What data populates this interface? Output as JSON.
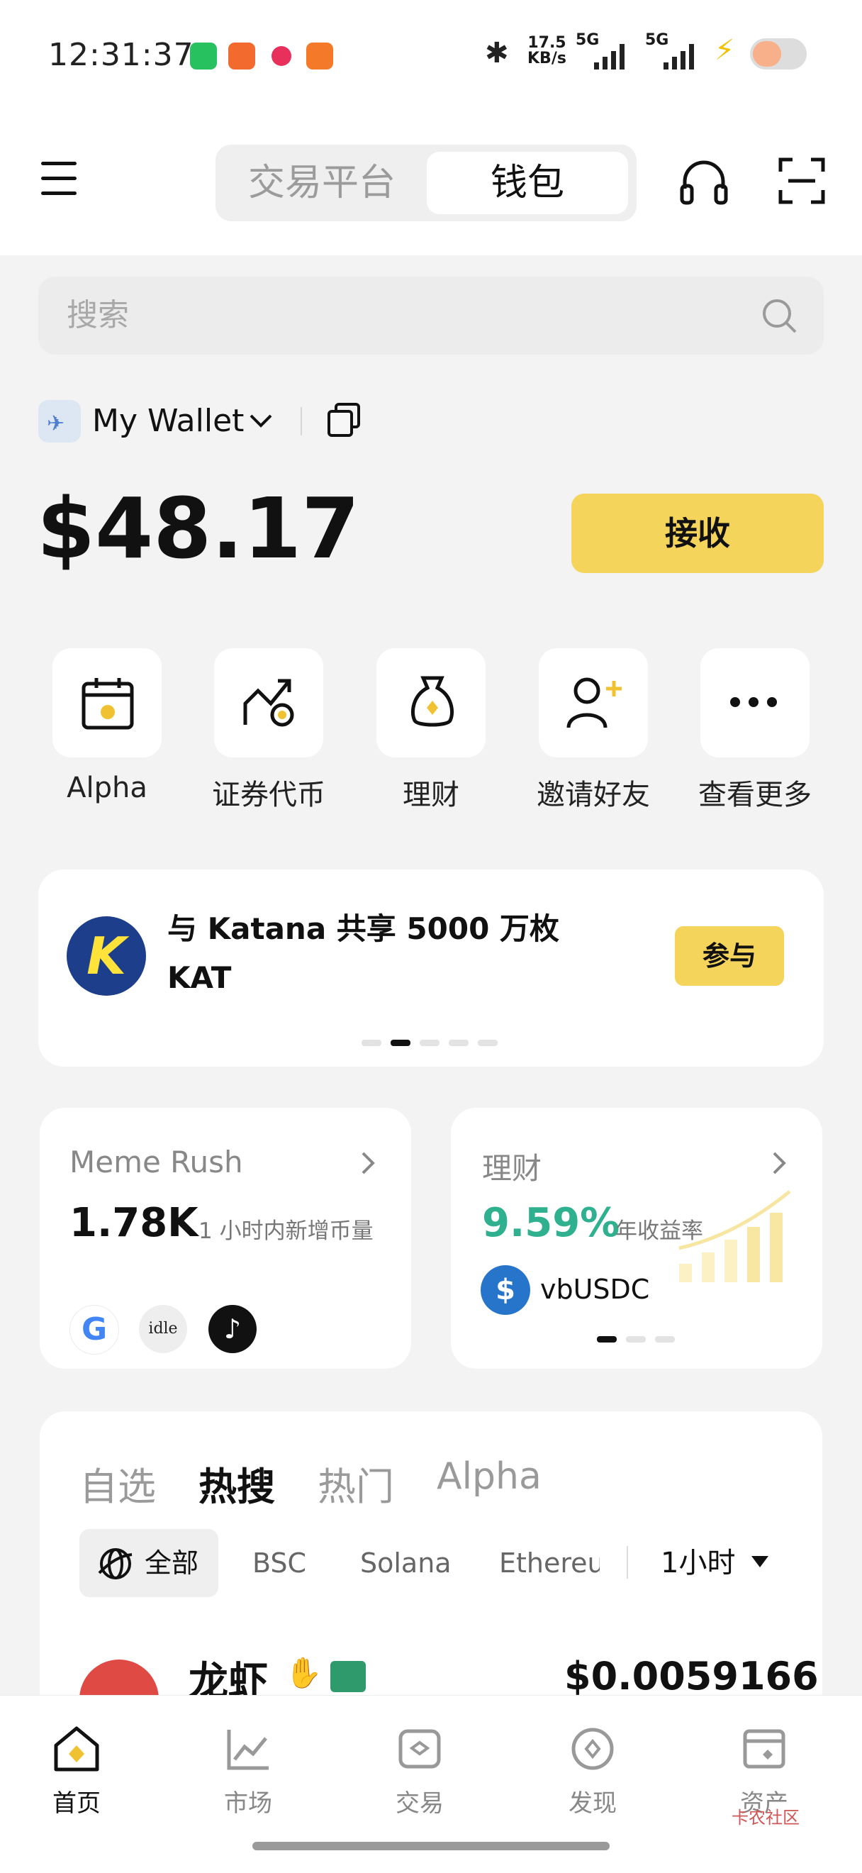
{
  "status_bar": {
    "time": "12:31:37",
    "net_speed_value": "17.5",
    "net_speed_unit": "KB/s",
    "signal_1": "5G",
    "signal_2": "5G"
  },
  "header": {
    "tabs": [
      {
        "label": "交易平台",
        "active": false
      },
      {
        "label": "钱包",
        "active": true
      }
    ],
    "support_icon": "headset-icon",
    "scan_icon": "scan-icon"
  },
  "search": {
    "placeholder": "搜索"
  },
  "wallet": {
    "name": "My Wallet",
    "balance": "$48.17",
    "receive_label": "接收"
  },
  "quick_actions": [
    {
      "label": "Alpha",
      "icon": "alpha-calendar-icon"
    },
    {
      "label": "证券代币",
      "icon": "stock-token-icon"
    },
    {
      "label": "理财",
      "icon": "money-bag-icon"
    },
    {
      "label": "邀请好友",
      "icon": "invite-friend-icon"
    },
    {
      "label": "查看更多",
      "icon": "more-icon"
    }
  ],
  "promo": {
    "line1": "与 Katana 共享 5000 万枚",
    "line2": "KAT",
    "button": "参与",
    "logo_letter": "K",
    "active_dot": 1,
    "dot_count": 5
  },
  "meme_card": {
    "title": "Meme Rush",
    "value": "1.78K",
    "desc": "1 小时内新增币量",
    "tokens": [
      "google-token-icon",
      "idle",
      "tiktok-token-icon"
    ]
  },
  "earn_card": {
    "title": "理财",
    "rate": "9.59%",
    "rate_label": "年收益率",
    "asset": "vbUSDC",
    "active_dot": 0,
    "dot_count": 3
  },
  "market": {
    "tabs": [
      {
        "label": "自选",
        "active": false
      },
      {
        "label": "热搜",
        "active": true
      },
      {
        "label": "热门",
        "active": false
      },
      {
        "label": "Alpha",
        "active": false
      }
    ],
    "filters": [
      "全部",
      "BSC",
      "Solana",
      "Ethereu"
    ],
    "timeframe": "1小时",
    "rows": [
      {
        "name": "龙虾",
        "price": "$0.0059166"
      }
    ]
  },
  "bottom_nav": [
    {
      "label": "首页",
      "active": true
    },
    {
      "label": "市场",
      "active": false
    },
    {
      "label": "交易",
      "active": false
    },
    {
      "label": "发现",
      "active": false
    },
    {
      "label": "资产",
      "active": false
    }
  ],
  "watermark": "卡农社区",
  "colors": {
    "accent_yellow": "#f5d45b",
    "green_rate": "#2fb08e",
    "usdc_blue": "#2775ca"
  }
}
